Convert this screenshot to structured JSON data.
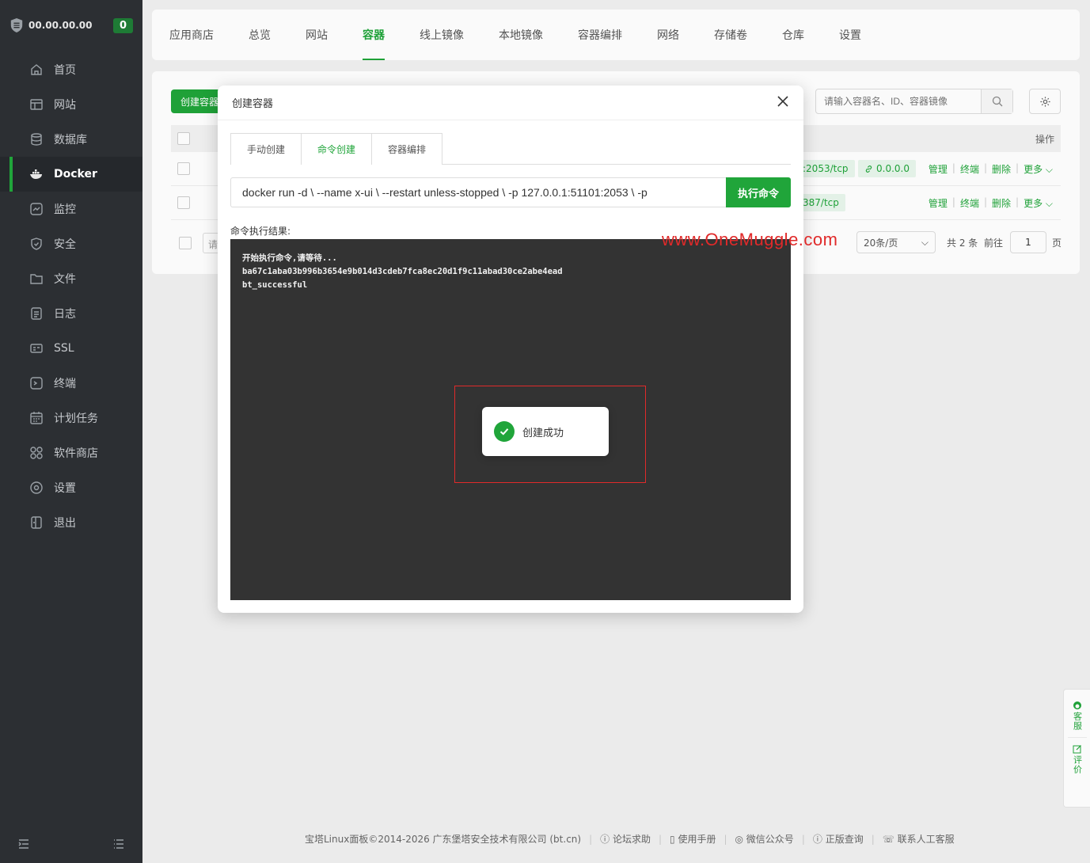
{
  "sidebar": {
    "ip": "00.00.00.00",
    "count": "0",
    "items": [
      {
        "label": "首页",
        "icon": "home-icon"
      },
      {
        "label": "网站",
        "icon": "website-icon"
      },
      {
        "label": "数据库",
        "icon": "database-icon"
      },
      {
        "label": "Docker",
        "icon": "docker-icon",
        "active": true
      },
      {
        "label": "监控",
        "icon": "monitor-icon"
      },
      {
        "label": "安全",
        "icon": "shield-icon"
      },
      {
        "label": "文件",
        "icon": "folder-icon"
      },
      {
        "label": "日志",
        "icon": "log-icon"
      },
      {
        "label": "SSL",
        "icon": "ssl-icon"
      },
      {
        "label": "终端",
        "icon": "terminal-icon"
      },
      {
        "label": "计划任务",
        "icon": "calendar-icon"
      },
      {
        "label": "软件商店",
        "icon": "apps-icon"
      },
      {
        "label": "设置",
        "icon": "settings-icon"
      },
      {
        "label": "退出",
        "icon": "logout-icon"
      }
    ]
  },
  "topnav": {
    "tabs": [
      "应用商店",
      "总览",
      "网站",
      "容器",
      "线上镜像",
      "本地镜像",
      "容器编排",
      "网络",
      "存储卷",
      "仓库",
      "设置"
    ],
    "active": "容器"
  },
  "main": {
    "create_button": "创建容器",
    "search_placeholder": "请输入容器名、ID、容器镜像",
    "column_ops": "操作",
    "rows": [
      {
        "port": ":2053/tcp",
        "port2": "0.0.0.0",
        "actions": [
          "管理",
          "终端",
          "删除",
          "更多"
        ]
      },
      {
        "port": "387/tcp",
        "actions": [
          "管理",
          "终端",
          "删除",
          "更多"
        ]
      }
    ],
    "pager": {
      "hint": "请",
      "page_size": "20条/页",
      "total": "共 2 条",
      "goto": "前往",
      "page": "1",
      "unit": "页"
    }
  },
  "watermark": "www.OneMuggle.com",
  "modal": {
    "title": "创建容器",
    "tabs": [
      "手动创建",
      "命令创建",
      "容器编排"
    ],
    "active_tab": "命令创建",
    "command": "docker run -d \\   --name x-ui \\   --restart unless-stopped \\   -p 127.0.0.1:51101:2053 \\   -p",
    "run_button": "执行命令",
    "result_label": "命令执行结果:",
    "console_lines": [
      "开始执行命令,请等待...",
      "ba67c1aba03b996b3654e9b014d3cdeb7fca8ec20d1f9c11abad30ce2abe4ead",
      "bt_successful"
    ]
  },
  "toast": {
    "text": "创建成功"
  },
  "float": {
    "service": "客服",
    "review": "评价"
  },
  "footer": {
    "copyright": "宝塔Linux面板©2014-2026 广东堡塔安全技术有限公司 (bt.cn)",
    "links": [
      "论坛求助",
      "使用手册",
      "微信公众号",
      "正版查询",
      "联系人工客服"
    ]
  },
  "colors": {
    "accent": "#20a53a",
    "sidebar_bg": "#2c2f33",
    "console_bg": "#333333",
    "annotation_red": "#e02a2a"
  }
}
